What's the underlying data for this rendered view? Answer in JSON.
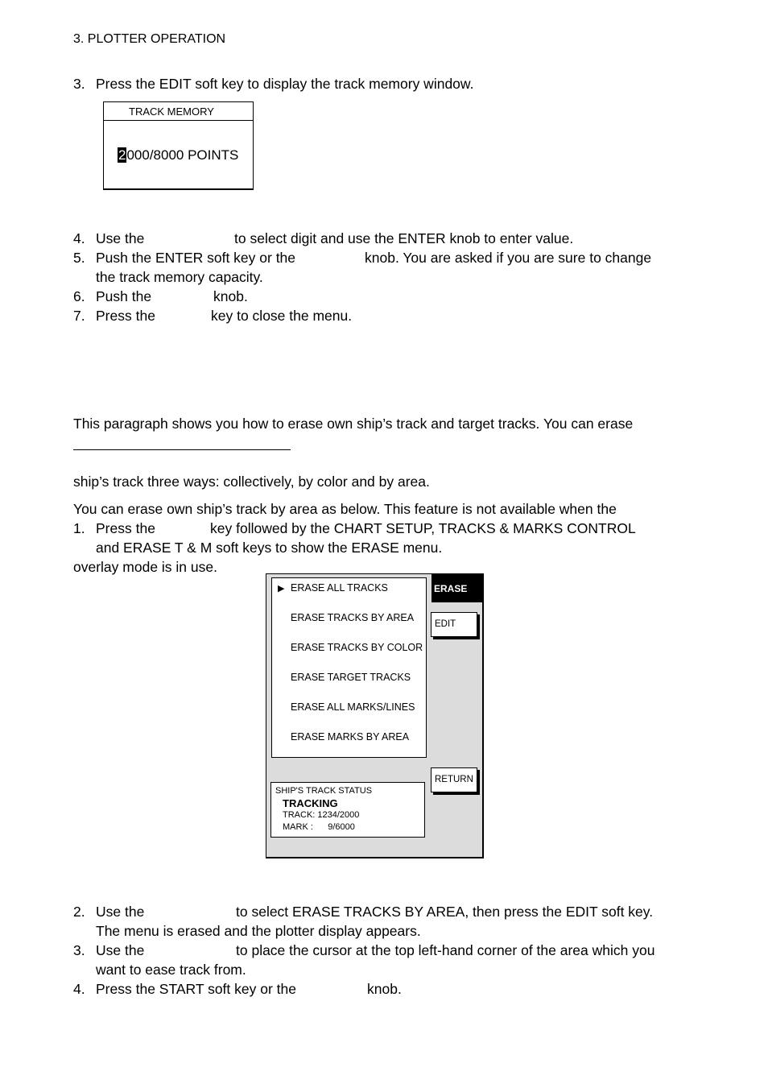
{
  "page_header": "3. PLOTTER OPERATION",
  "steps_a": [
    {
      "num": "3.",
      "text": "Press the EDIT soft key to display the track memory window."
    }
  ],
  "track_memory": {
    "title": "TRACK MEMORY",
    "cursor_digit": "2",
    "value_rest": "000/8000 POINTS"
  },
  "steps_b": [
    {
      "num": "4.",
      "pre": "Use the",
      "post": "to select digit and use the ENTER knob to enter value."
    },
    {
      "num": "5.",
      "pre": "Push the ENTER soft key or the",
      "post": "knob. You are asked if you are sure to change",
      "cont": "the track memory capacity."
    },
    {
      "num": "6.",
      "pre": "Push the",
      "post": "knob."
    },
    {
      "num": "7.",
      "pre": "Press the",
      "post": "key to close the menu."
    }
  ],
  "intro_paragraph": [
    "This paragraph shows you how to erase own ship’s track and target tracks. You can erase",
    "ship’s track three ways: collectively, by color and by area."
  ],
  "area_paragraph": [
    "You can erase own ship’s track by area as below. This feature is not available when the",
    "overlay mode is in use."
  ],
  "steps_c": [
    {
      "num": "1.",
      "pre": "Press the",
      "post": "key followed by the CHART SETUP, TRACKS & MARKS CONTROL",
      "cont": "and ERASE T & M soft keys to show the ERASE menu."
    }
  ],
  "erase_menu": {
    "selection_icon": "triangle-right",
    "arrow_glyph": "▶",
    "items": [
      "ERASE ALL TRACKS",
      "ERASE TRACKS BY AREA",
      "ERASE TRACKS BY COLOR",
      "ERASE TARGET TRACKS",
      "ERASE ALL MARKS/LINES",
      "ERASE MARKS BY AREA"
    ],
    "selected_index": 0,
    "header": "ERASE",
    "edit_label": "EDIT",
    "return_label": "RETURN",
    "status": {
      "title": "SHIP'S TRACK STATUS",
      "state": "TRACKING",
      "track": "TRACK: 1234/2000",
      "mark": "MARK :      9/6000"
    }
  },
  "steps_d": [
    {
      "num": "2.",
      "pre": "Use the",
      "post": "to select ERASE TRACKS BY AREA, then press the EDIT soft key.",
      "cont": "The menu is erased and the plotter display appears."
    },
    {
      "num": "3.",
      "pre": "Use the",
      "post": "to place the cursor at the top left-hand corner of the area which you",
      "cont": "want to ease track from."
    },
    {
      "num": "4.",
      "pre": "Press the START soft key or the",
      "post": "knob."
    }
  ]
}
